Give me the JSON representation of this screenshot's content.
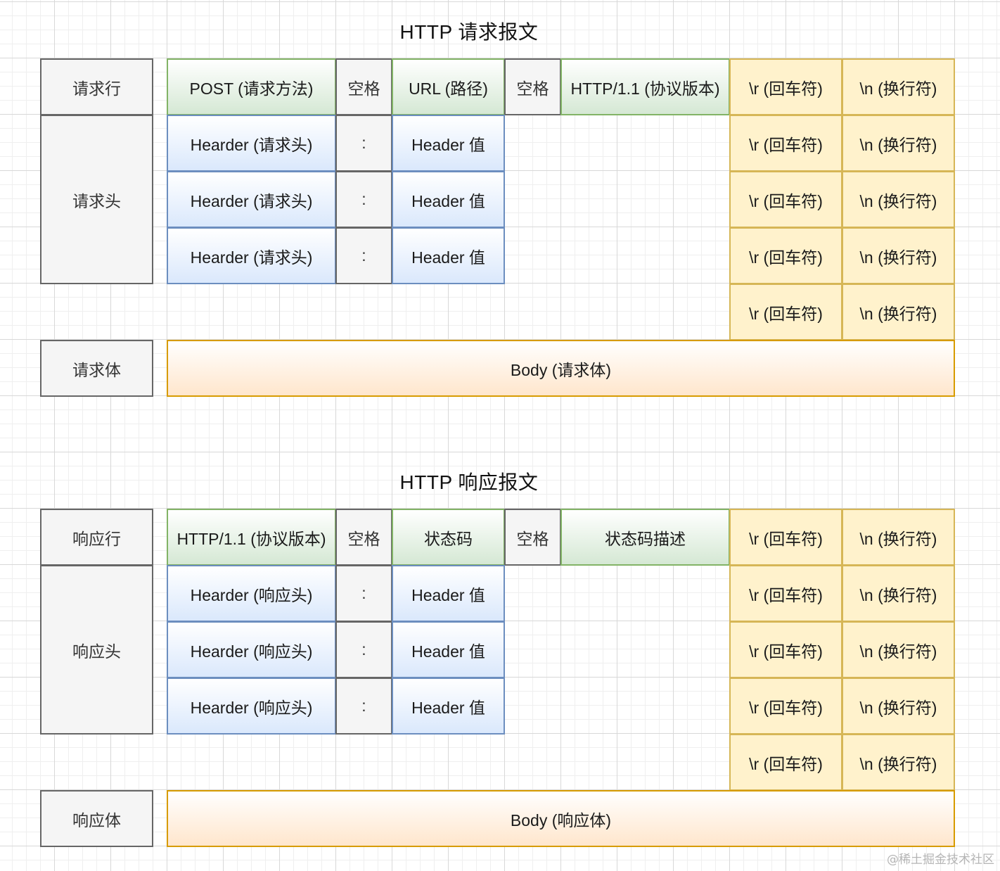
{
  "request": {
    "title": "HTTP 请求报文",
    "row_label_line": "请求行",
    "row_label_headers": "请求头",
    "row_label_body": "请求体",
    "line": {
      "method": "POST (请求方法)",
      "space1": "空格",
      "url": "URL (路径)",
      "space2": "空格",
      "version": "HTTP/1.1 (协议版本)"
    },
    "headers": [
      {
        "name": "Hearder (请求头)",
        "colon": ":",
        "value": "Header 值"
      },
      {
        "name": "Hearder (请求头)",
        "colon": ":",
        "value": "Header 值"
      },
      {
        "name": "Hearder (请求头)",
        "colon": ":",
        "value": "Header 值"
      }
    ],
    "body": "Body (请求体)"
  },
  "response": {
    "title": "HTTP 响应报文",
    "row_label_line": "响应行",
    "row_label_headers": "响应头",
    "row_label_body": "响应体",
    "line": {
      "version": "HTTP/1.1 (协议版本)",
      "space1": "空格",
      "status_code": "状态码",
      "space2": "空格",
      "status_text": "状态码描述"
    },
    "headers": [
      {
        "name": "Hearder (响应头)",
        "colon": ":",
        "value": "Header 值"
      },
      {
        "name": "Hearder (响应头)",
        "colon": ":",
        "value": "Header 值"
      },
      {
        "name": "Hearder (响应头)",
        "colon": ":",
        "value": "Header 值"
      }
    ],
    "body": "Body (响应体)"
  },
  "crlf": {
    "cr": "\\r (回车符)",
    "lf": "\\n (换行符)"
  },
  "watermark": "@稀土掘金技术社区",
  "colors": {
    "label_fill": "#f5f5f5",
    "label_stroke": "#666666",
    "line_fill": "#d5e8d4",
    "line_stroke": "#82b366",
    "header_fill": "#dae8fc",
    "header_stroke": "#6c8ebf",
    "crlf_fill": "#fff2cc",
    "crlf_stroke": "#d6b656",
    "body_fill": "#ffe6cc",
    "body_stroke": "#d79b00"
  }
}
